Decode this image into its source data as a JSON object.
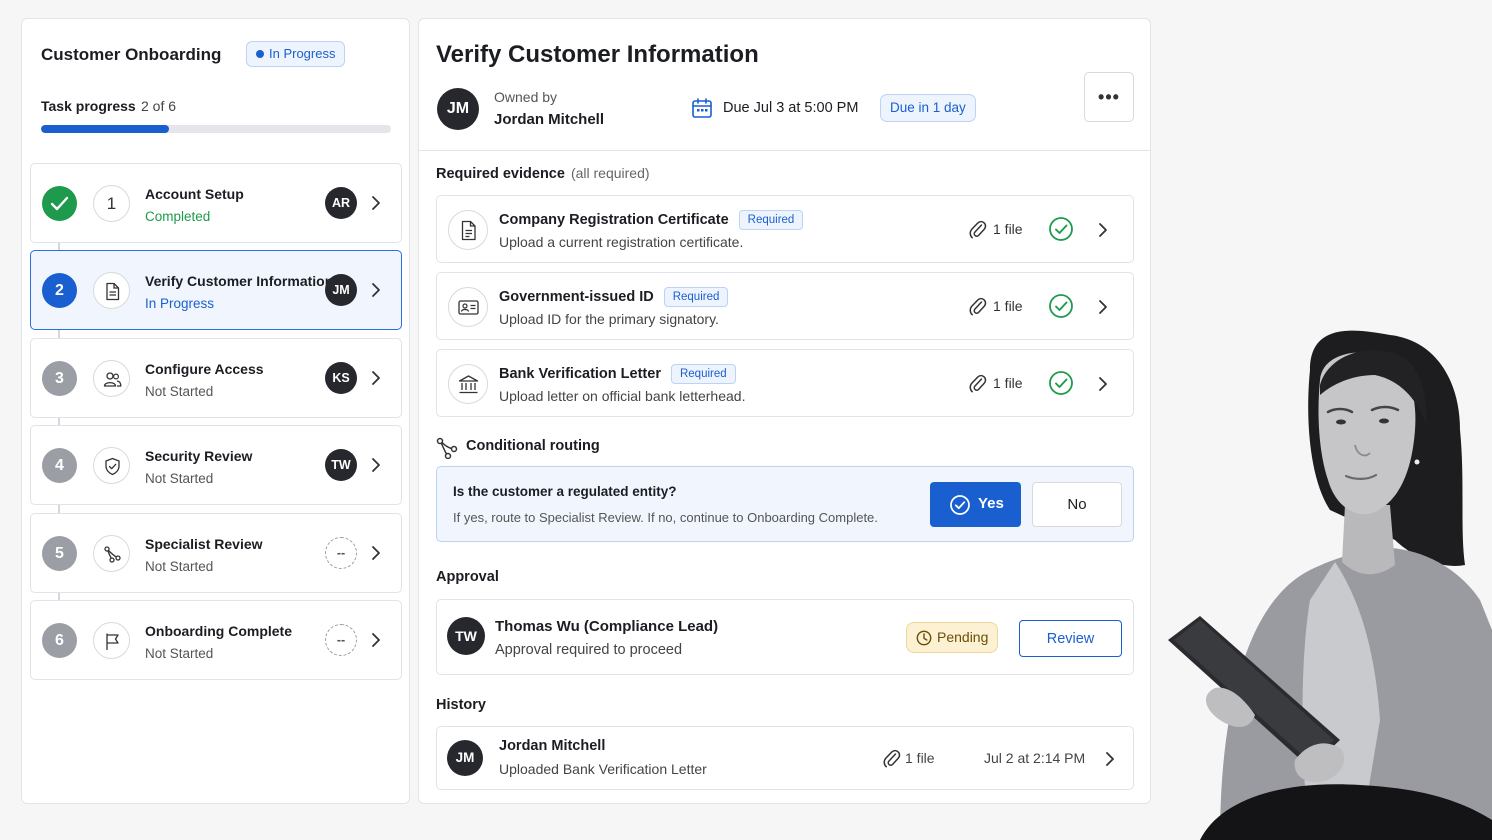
{
  "sidebar": {
    "title": "Customer Onboarding",
    "status_badge": "In Progress",
    "progress_label": "Task progress",
    "progress_count": "2 of 6",
    "progress_fraction": 0.3667,
    "steps": [
      {
        "number": "1",
        "title": "Account Setup",
        "status": "Completed",
        "assignee": "AR",
        "icon": "check-icon"
      },
      {
        "number": "2",
        "title": "Verify Customer Information",
        "status": "In Progress",
        "assignee": "JM",
        "icon": "document-icon"
      },
      {
        "number": "3",
        "title": "Configure Access",
        "status": "Not Started",
        "assignee": "KS",
        "icon": "users-icon"
      },
      {
        "number": "4",
        "title": "Security Review",
        "status": "Not Started",
        "assignee": "TW",
        "icon": "shield-icon"
      },
      {
        "number": "5",
        "title": "Specialist Review",
        "status": "Not Started",
        "assignee": "--",
        "icon": "branch-icon"
      },
      {
        "number": "6",
        "title": "Onboarding Complete",
        "status": "Not Started",
        "assignee": "--",
        "icon": "flag-icon"
      }
    ]
  },
  "task": {
    "title": "Verify Customer Information",
    "owner_initials": "JM",
    "owned_by_label": "Owned by",
    "owner_name": "Jordan Mitchell",
    "due_text": "Due Jul 3 at 5:00 PM",
    "due_badge": "Due in 1 day",
    "more_label": "•••"
  },
  "evidence": {
    "section_title": "Required evidence",
    "section_sub": "(all required)",
    "items": [
      {
        "title": "Company Registration Certificate",
        "badge": "Required",
        "desc": "Upload a current registration certificate.",
        "files": "1 file",
        "icon": "document-icon"
      },
      {
        "title": "Government-issued ID",
        "badge": "Required",
        "desc": "Upload ID for the primary signatory.",
        "files": "1 file",
        "icon": "id-card-icon"
      },
      {
        "title": "Bank Verification Letter",
        "badge": "Required",
        "desc": "Upload letter on official bank letterhead.",
        "files": "1 file",
        "icon": "bank-icon"
      }
    ]
  },
  "routing": {
    "section_title": "Conditional routing",
    "question": "Is the customer a regulated entity?",
    "help": "If yes, route to Specialist Review. If no, continue to Onboarding Complete.",
    "yes_label": "Yes",
    "no_label": "No"
  },
  "approval": {
    "section_title": "Approval",
    "initials": "TW",
    "name": "Thomas Wu (Compliance Lead)",
    "desc": "Approval required to proceed",
    "status": "Pending",
    "action_label": "Review"
  },
  "history": {
    "section_title": "History",
    "initials": "JM",
    "name": "Jordan Mitchell",
    "desc": "Uploaded Bank Verification Letter",
    "files": "1 file",
    "time": "Jul 2 at 2:14 PM"
  },
  "colors": {
    "accent": "#1a5fd0",
    "success": "#1e9a4c",
    "pending_bg": "#fcf1d2"
  }
}
